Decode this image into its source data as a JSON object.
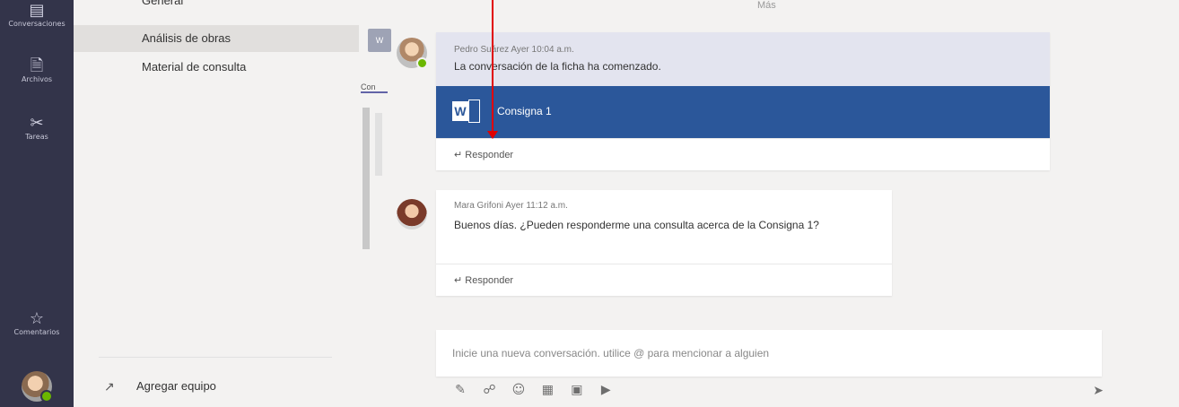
{
  "rail": {
    "items": [
      {
        "label": "Conversaciones",
        "icon": "chat-icon"
      },
      {
        "label": "Archivos",
        "icon": "files-icon"
      },
      {
        "label": "Tareas",
        "icon": "tasks-icon"
      },
      {
        "label": "Comentarios",
        "icon": "feedback-icon"
      }
    ]
  },
  "channels": {
    "partial": "General",
    "items": [
      {
        "label": "Análisis de obras",
        "active": true
      },
      {
        "label": "Material de consulta",
        "active": false
      }
    ],
    "add_team": "Agregar equipo"
  },
  "main": {
    "top_text": "Más",
    "tab_icon_text": "W",
    "tab_label": "Con",
    "messages": [
      {
        "author": "Pedro Suárez",
        "time": "Ayer 10:04 a.m.",
        "meta": "Pedro Suárez  Ayer 10:04 a.m.",
        "body": "La conversación de la ficha ha comenzado.",
        "attachment": {
          "type": "word",
          "title": "Consigna 1"
        },
        "reply_label": "Responder"
      },
      {
        "author": "Mara Grifoni",
        "time": "Ayer 11:12 a.m.",
        "meta": "Mara Grifoni  Ayer 11:12 a.m.",
        "body": "Buenos días. ¿Pueden responderme una consulta acerca de la Consigna 1?",
        "reply_label": "Responder"
      }
    ],
    "compose": {
      "placeholder": "Inicie una nueva conversación. utilice @ para mencionar a alguien",
      "tools": [
        "format-icon",
        "attach-icon",
        "emoji-icon",
        "gif-icon",
        "sticker-icon",
        "meet-now-icon"
      ],
      "send_icon": "send-icon"
    }
  },
  "colors": {
    "rail_bg": "#33344a",
    "word_blue": "#2b579a",
    "card_header": "#e3e4ef",
    "presence_green": "#6bb700",
    "annotation_red": "#e00000"
  }
}
